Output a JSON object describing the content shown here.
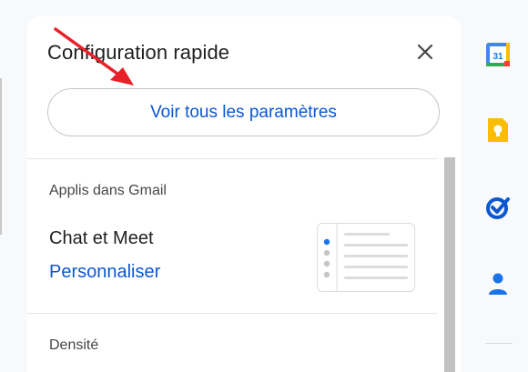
{
  "panel": {
    "title": "Configuration rapide",
    "see_all_label": "Voir tous les paramètres",
    "section_apps_label": "Applis dans Gmail",
    "chat_meet_title": "Chat et Meet",
    "customize_link": "Personnaliser",
    "section_density_label": "Densité"
  },
  "icons": {
    "close": "close-icon",
    "calendar": "google-calendar-icon",
    "keep": "google-keep-icon",
    "tasks": "google-tasks-icon",
    "contacts": "google-contacts-icon"
  },
  "rail": {
    "calendar_day": "31"
  },
  "colors": {
    "accent": "#0b57d0",
    "annotation": "#e8202a",
    "keep_yellow": "#fbbc04",
    "tasks_blue": "#0b57d0",
    "contacts_blue": "#1a73e8"
  }
}
